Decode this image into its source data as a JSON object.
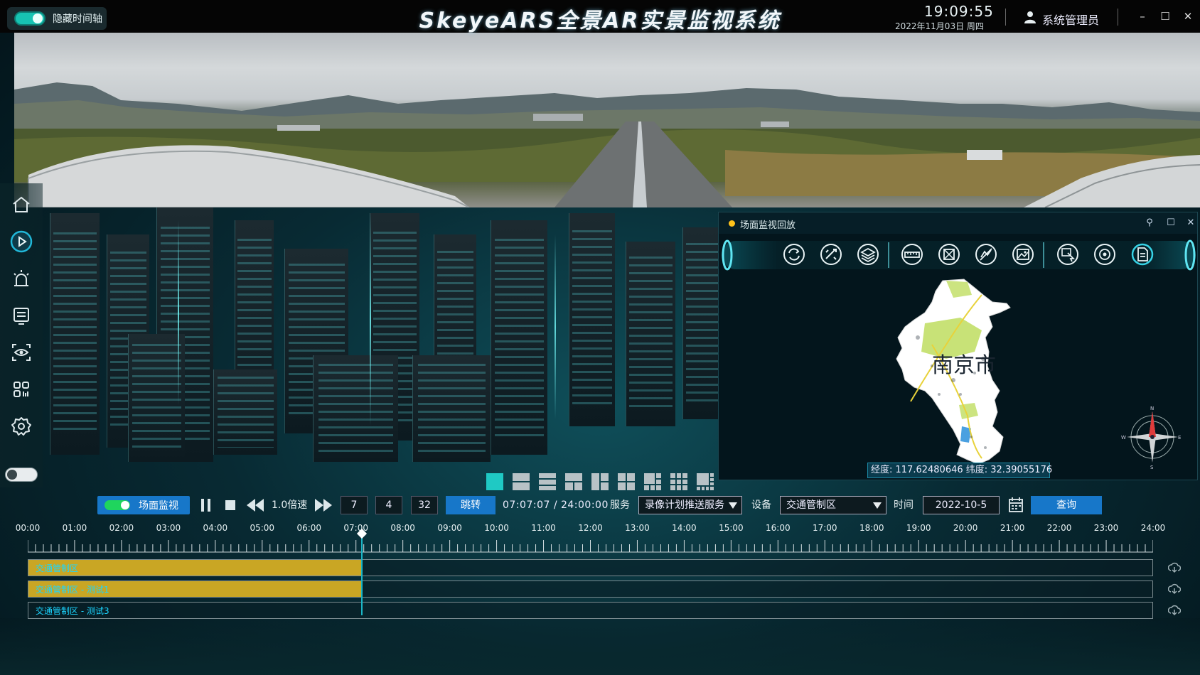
{
  "header": {
    "timeline_toggle_label": "隐藏时间轴",
    "title": "SkeyeARS全景AR实景监视系统",
    "clock_time": "19:09:55",
    "clock_date": "2022年11月03日 周四",
    "user_name": "系统管理员",
    "window_controls": [
      "minimize-icon",
      "maximize-icon",
      "close-icon"
    ]
  },
  "sidebar": {
    "items": [
      {
        "name": "home",
        "icon": "home-icon"
      },
      {
        "name": "playback",
        "icon": "play-circle-icon"
      },
      {
        "name": "alarm",
        "icon": "alarm-icon"
      },
      {
        "name": "list",
        "icon": "list-icon"
      },
      {
        "name": "view",
        "icon": "eye-scan-icon"
      },
      {
        "name": "apps",
        "icon": "grid-icon"
      },
      {
        "name": "settings",
        "icon": "gear-icon"
      }
    ],
    "toggle_state": "off"
  },
  "popup": {
    "title": "场面监视回放",
    "tools": [
      "refresh-icon",
      "edit-map-icon",
      "layers-icon",
      "ruler-icon",
      "area-icon",
      "no-area-icon",
      "image-icon",
      "cursor-icon",
      "target-icon",
      "document-icon"
    ],
    "map_label": "南京市",
    "coord_text": "经度: 117.62480646  纬度: 32.39055176"
  },
  "controls": {
    "mode_label": "场面监视",
    "speed_label": "1.0倍速",
    "hour": "7",
    "minute": "4",
    "second": "32",
    "jump_label": "跳转",
    "time_display": "07:07:07 / 24:00:00",
    "service_label": "服务",
    "service_value": "录像计划推送服务",
    "device_label": "设备",
    "device_value": "交通管制区",
    "time_label": "时间",
    "date_value": "2022-10-5",
    "query_label": "查询"
  },
  "timeline": {
    "hours": [
      "00:00",
      "01:00",
      "02:00",
      "03:00",
      "04:00",
      "05:00",
      "06:00",
      "07:00",
      "08:00",
      "09:00",
      "10:00",
      "11:00",
      "12:00",
      "13:00",
      "14:00",
      "15:00",
      "16:00",
      "17:00",
      "18:00",
      "19:00",
      "20:00",
      "21:00",
      "22:00",
      "23:00",
      "24:00"
    ],
    "cursor_hour": 7.12,
    "tracks": [
      {
        "label": "交通管制区",
        "recorded_until_hour": 7.12
      },
      {
        "label": "交通管制区 - 测试1",
        "recorded_until_hour": 7.12
      },
      {
        "label": "交通管制区 - 测试3",
        "recorded_until_hour": 0
      }
    ]
  },
  "colors": {
    "accent": "#1777c9",
    "teal": "#17c3b2",
    "track_fill": "#c9a624",
    "track_label": "#1bd5ff"
  }
}
